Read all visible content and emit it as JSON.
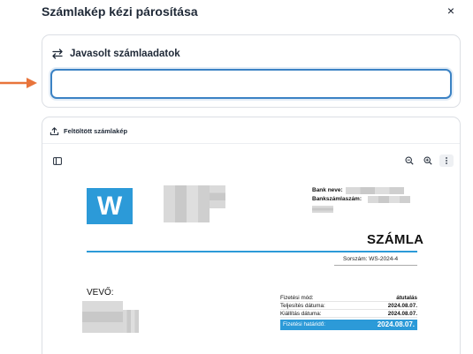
{
  "dialog": {
    "title": "Számlakép kézi párosítása",
    "close_label": "×"
  },
  "suggest": {
    "heading": "Javasolt számlaadatok",
    "input_value": "",
    "input_placeholder": ""
  },
  "upload": {
    "heading": "Feltöltött számlakép"
  },
  "invoice": {
    "logo_letter": "W",
    "bank_name_label": "Bank neve:",
    "bank_account_label": "Bankszámlaszám:",
    "title": "SZÁMLA",
    "serial": "Sorszám: WS-2024-4",
    "buyer_label": "VEVŐ:",
    "payment_rows": [
      {
        "label": "Fizetési mód:",
        "value": "átutalás"
      },
      {
        "label": "Teljesítés dátuma:",
        "value": "2024.08.07."
      },
      {
        "label": "Kiállítás dátuma:",
        "value": "2024.08.07."
      }
    ],
    "due": {
      "label": "Fizetési határidő:",
      "value": "2024.08.07."
    }
  },
  "colors": {
    "accent": "#2c9ad8",
    "focus_border": "#3b82c4",
    "arrow": "#e8743b"
  }
}
